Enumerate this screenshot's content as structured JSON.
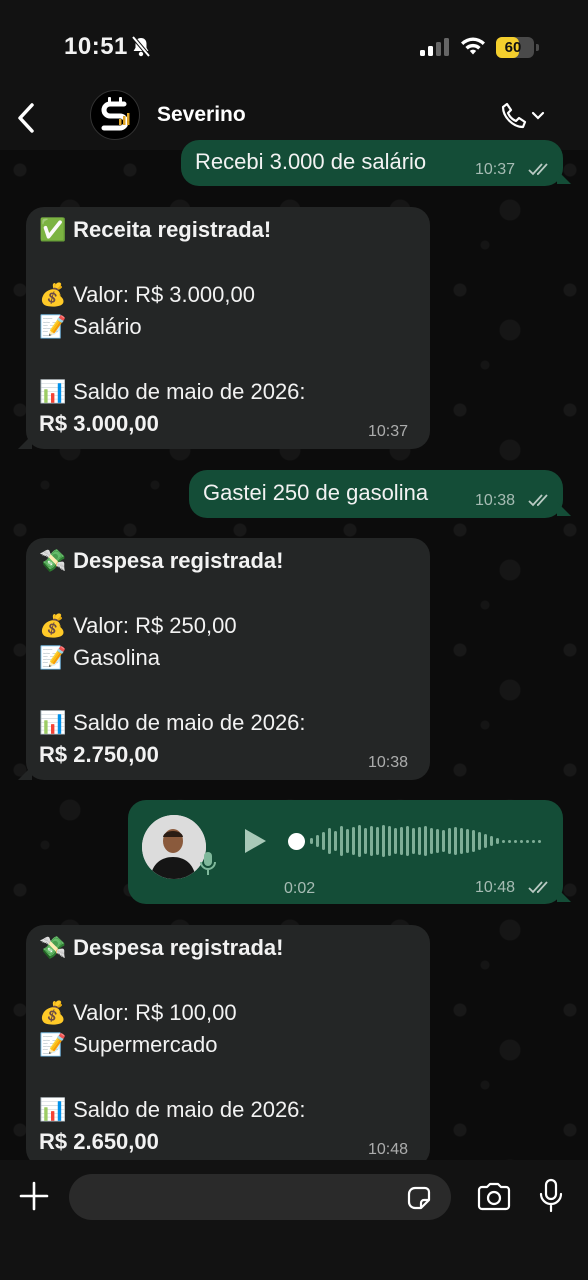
{
  "status_bar": {
    "time": "10:51",
    "battery": "60",
    "battery_level": 0.6
  },
  "header": {
    "contact_name": "Severino",
    "avatar_letter": "S"
  },
  "messages": [
    {
      "type": "out",
      "text": "Recebi 3.000 de salário",
      "time": "10:37",
      "status": "read"
    },
    {
      "type": "in",
      "title_emoji": "✅",
      "title": "Receita registrada!",
      "value_emoji": "💰",
      "value": "Valor: R$ 3.000,00",
      "note_emoji": "📝",
      "note": "Salário",
      "balance_emoji": "📊",
      "balance_label": "Saldo de maio de 2026:",
      "balance": "R$ 3.000,00",
      "time": "10:37"
    },
    {
      "type": "out",
      "text": "Gastei 250 de gasolina",
      "time": "10:38",
      "status": "read"
    },
    {
      "type": "in",
      "title_emoji": "💸",
      "title": "Despesa registrada!",
      "value_emoji": "💰",
      "value": "Valor: R$ 250,00",
      "note_emoji": "📝",
      "note": "Gasolina",
      "balance_emoji": "📊",
      "balance_label": "Saldo de maio de 2026:",
      "balance": "R$ 2.750,00",
      "time": "10:38"
    },
    {
      "type": "voice",
      "duration": "0:02",
      "time": "10:48",
      "status": "read"
    },
    {
      "type": "in",
      "title_emoji": "💸",
      "title": "Despesa registrada!",
      "value_emoji": "💰",
      "value": "Valor: R$ 100,00",
      "note_emoji": "📝",
      "note": "Supermercado",
      "balance_emoji": "📊",
      "balance_label": "Saldo de maio de 2026:",
      "balance": "R$ 2.650,00",
      "time": "10:48"
    }
  ],
  "input": {
    "placeholder": ""
  },
  "colors": {
    "outgoing": "#144d37",
    "incoming": "#242626",
    "background": "#0b0b0b",
    "battery": "#f4cf2d"
  }
}
